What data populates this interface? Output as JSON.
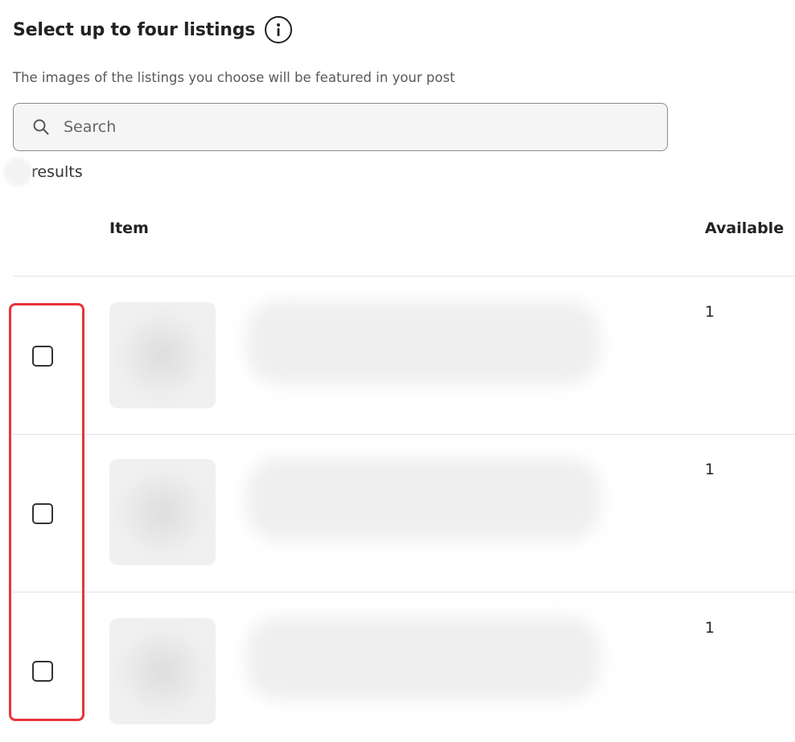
{
  "header": {
    "title": "Select up to four listings",
    "info_icon": "info-icon",
    "subtitle": "The images of the listings you choose will be featured in your post"
  },
  "search": {
    "placeholder": "Search",
    "value": "",
    "icon": "search-icon"
  },
  "results": {
    "label": "results"
  },
  "table": {
    "columns": [
      "Item",
      "Available"
    ],
    "rows": [
      {
        "checked": false,
        "available": "1"
      },
      {
        "checked": false,
        "available": "1"
      },
      {
        "checked": false,
        "available": "1"
      }
    ]
  },
  "colors": {
    "highlight": "#e8343a",
    "text": "#222222",
    "muted": "#595959",
    "search_bg": "#f5f5f5"
  }
}
